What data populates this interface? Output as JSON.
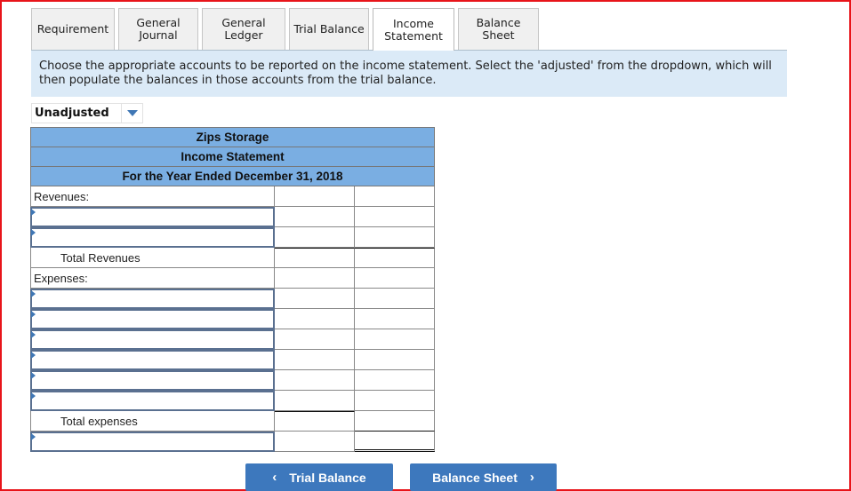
{
  "tabs": [
    {
      "lines": [
        "Requirement"
      ],
      "active": false
    },
    {
      "lines": [
        "General",
        "Journal"
      ],
      "active": false
    },
    {
      "lines": [
        "General",
        "Ledger"
      ],
      "active": false
    },
    {
      "lines": [
        "Trial Balance"
      ],
      "active": false
    },
    {
      "lines": [
        "Income",
        "Statement"
      ],
      "active": true
    },
    {
      "lines": [
        "Balance Sheet"
      ],
      "active": false
    }
  ],
  "instructions": "Choose the appropriate accounts to be reported on the income statement. Select the 'adjusted' from the dropdown, which will then populate the balances in those accounts from the trial balance.",
  "dropdown": {
    "selected": "Unadjusted",
    "icon": "chevron-down-icon"
  },
  "statement": {
    "company": "Zips Storage",
    "title": "Income Statement",
    "period": "For the Year Ended December 31, 2018",
    "labels": {
      "revenues": "Revenues:",
      "total_revenues": "Total Revenues",
      "expenses": "Expenses:",
      "total_expenses": "Total expenses"
    },
    "revenue_rows": [
      {
        "account": "",
        "amount": "",
        "total": ""
      },
      {
        "account": "",
        "amount": "",
        "total": ""
      }
    ],
    "expense_rows": [
      {
        "account": "",
        "amount": "",
        "total": ""
      },
      {
        "account": "",
        "amount": "",
        "total": ""
      },
      {
        "account": "",
        "amount": "",
        "total": ""
      },
      {
        "account": "",
        "amount": "",
        "total": ""
      },
      {
        "account": "",
        "amount": "",
        "total": ""
      },
      {
        "account": "",
        "amount": "",
        "total": ""
      }
    ],
    "net_row": {
      "account": "",
      "amount": "",
      "total": ""
    }
  },
  "nav": {
    "prev_label": "Trial Balance",
    "next_label": "Balance Sheet",
    "prev_icon": "‹",
    "next_icon": "›"
  }
}
